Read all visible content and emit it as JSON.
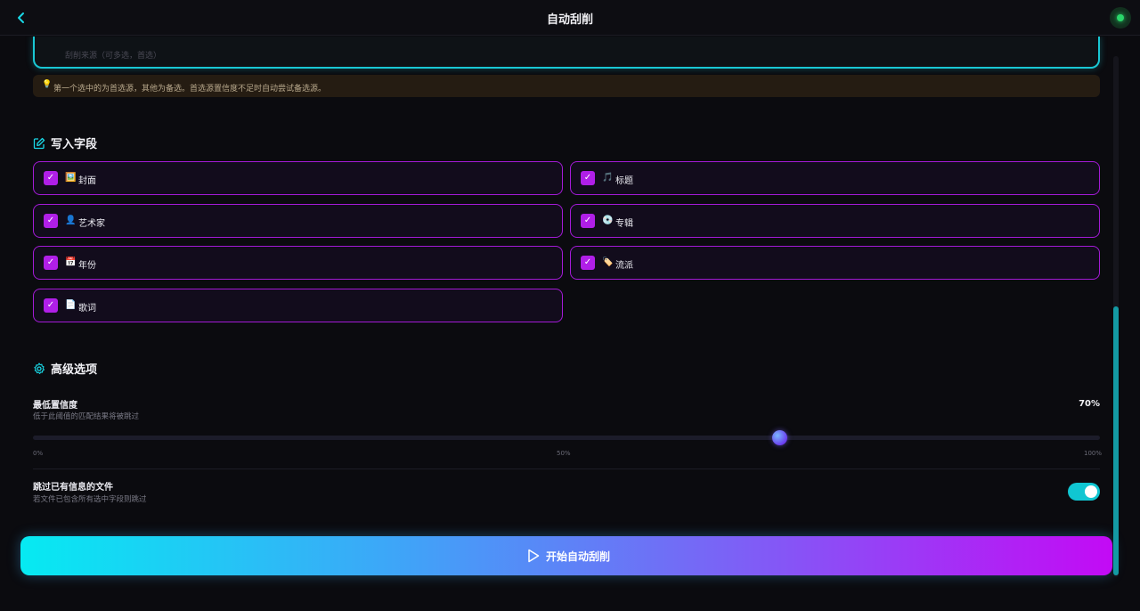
{
  "header": {
    "back_icon": "chevron-left-icon",
    "title": "自动刮削",
    "status_color": "#2ad66a"
  },
  "sources": {
    "partial_text": "刮削来源（可多选，首选）",
    "hint": "第一个选中的为首选源，其他为备选。首选源置信度不足时自动尝试备选源。"
  },
  "write_fields": {
    "title": "写入字段",
    "icon": "edit-icon",
    "items": [
      {
        "label": "封面",
        "emoji": "🖼️",
        "checked": true
      },
      {
        "label": "标题",
        "emoji": "🎵",
        "checked": true
      },
      {
        "label": "艺术家",
        "emoji": "👤",
        "checked": true
      },
      {
        "label": "专辑",
        "emoji": "💿",
        "checked": true
      },
      {
        "label": "年份",
        "emoji": "📅",
        "checked": true
      },
      {
        "label": "流派",
        "emoji": "🏷️",
        "checked": true
      },
      {
        "label": "歌词",
        "emoji": "📄",
        "checked": true
      }
    ]
  },
  "advanced": {
    "title": "高级选项",
    "icon": "gear-icon",
    "confidence": {
      "label": "最低置信度",
      "desc": "低于此阈值的匹配结果将被跳过",
      "value_text": "70%",
      "value": 0.7,
      "ticks": [
        "0%",
        "50%",
        "100%"
      ]
    },
    "skip_existing": {
      "label": "跳过已有信息的文件",
      "desc": "若文件已包含所有选中字段则跳过",
      "enabled": true
    }
  },
  "start_button": {
    "label": "开始自动刮削",
    "icon": "play-icon"
  },
  "colors": {
    "accent_cyan": "#19d8e6",
    "accent_purple": "#b01fe8"
  }
}
